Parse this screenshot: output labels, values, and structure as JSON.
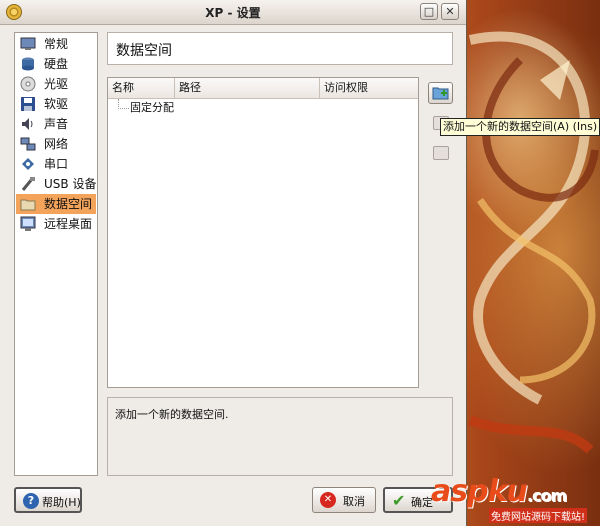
{
  "window": {
    "title": "XP - 设置"
  },
  "titlebar_buttons": {
    "maximize": "□",
    "close": "✕"
  },
  "sidebar": {
    "items": [
      {
        "label": "常规",
        "icon": "monitor-icon"
      },
      {
        "label": "硬盘",
        "icon": "harddisk-icon"
      },
      {
        "label": "光驱",
        "icon": "cdrom-icon"
      },
      {
        "label": "软驱",
        "icon": "floppy-icon"
      },
      {
        "label": "声音",
        "icon": "speaker-icon"
      },
      {
        "label": "网络",
        "icon": "network-icon"
      },
      {
        "label": "串口",
        "icon": "serial-port-icon"
      },
      {
        "label": "USB 设备",
        "icon": "usb-icon"
      },
      {
        "label": "数据空间",
        "icon": "folder-icon",
        "selected": true
      },
      {
        "label": "远程桌面",
        "icon": "remote-desktop-icon"
      }
    ]
  },
  "main": {
    "title": "数据空间",
    "table": {
      "columns": [
        "名称",
        "路径",
        "访问权限"
      ],
      "rows": [
        {
          "name": "固定分配"
        }
      ]
    },
    "tooltip": "添加一个新的数据空间(A) (Ins)",
    "description": "添加一个新的数据空间."
  },
  "buttons": {
    "help": "帮助(H)",
    "cancel": "取消",
    "ok": "确定",
    "help_icon": "?",
    "cancel_icon": "✕",
    "ok_icon": "✔"
  },
  "watermark": {
    "brand": "aspku",
    "domain": ".com",
    "subtitle": "免费网站源码下载站!"
  },
  "colors": {
    "selection": "#f3a35a",
    "window_bg": "#efebe7",
    "tooltip_bg": "#fffdd6"
  }
}
